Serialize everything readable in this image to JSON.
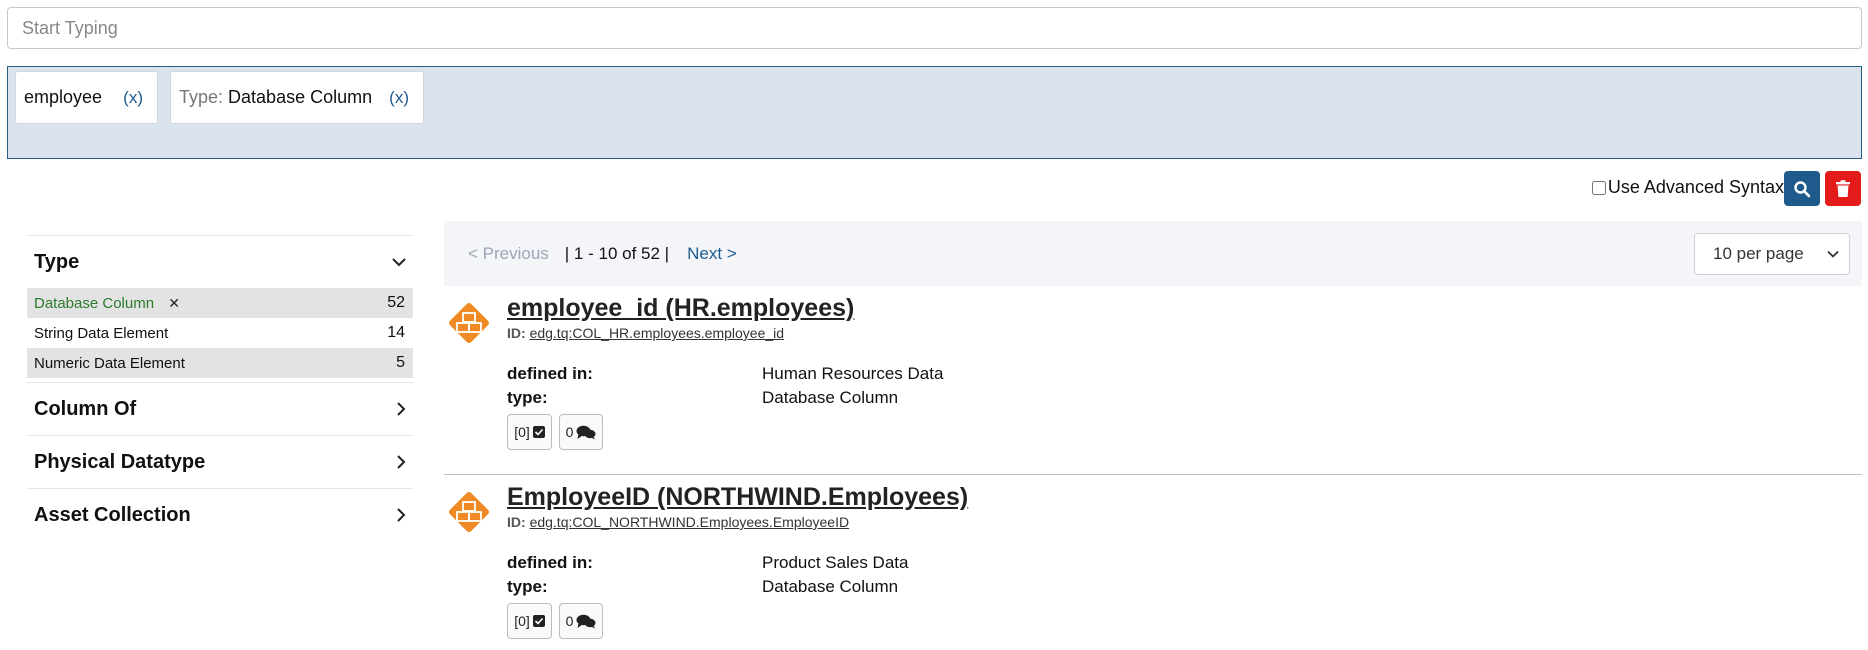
{
  "search": {
    "placeholder": "Start Typing"
  },
  "filters": [
    {
      "label": "",
      "value": "employee",
      "remove": "(x)"
    },
    {
      "label": "Type:",
      "value": "Database Column",
      "remove": "(x)"
    }
  ],
  "advanced": {
    "label": "Use Advanced Syntax",
    "checked": false
  },
  "buttons": {
    "search": "search-icon",
    "clear": "trash-icon"
  },
  "facets": {
    "type": {
      "title": "Type",
      "items": [
        {
          "label": "Database Column",
          "count": "52",
          "selected": true
        },
        {
          "label": "String Data Element",
          "count": "14"
        },
        {
          "label": "Numeric Data Element",
          "count": "5"
        }
      ]
    },
    "column_of": {
      "title": "Column Of"
    },
    "physical_datatype": {
      "title": "Physical Datatype"
    },
    "asset_collection": {
      "title": "Asset Collection"
    }
  },
  "pager": {
    "previous": "< Previous",
    "range": "| 1 - 10 of 52 |",
    "next": "Next >",
    "per_page": "10 per page"
  },
  "results": [
    {
      "title": "employee_id (HR.employees)",
      "id_label": "ID:",
      "id_value": "edg.tq:COL_HR.employees.employee_id",
      "defined_in_label": "defined in:",
      "defined_in": "Human Resources Data",
      "type_label": "type:",
      "type": "Database Column",
      "tasks": "[0]",
      "comments": "0"
    },
    {
      "title": "EmployeeID (NORTHWIND.Employees)",
      "id_label": "ID:",
      "id_value": "edg.tq:COL_NORTHWIND.Employees.EmployeeID",
      "defined_in_label": "defined in:",
      "defined_in": "Product Sales Data",
      "type_label": "type:",
      "type": "Database Column",
      "tasks": "[0]",
      "comments": "0"
    }
  ],
  "colors": {
    "accent": "#1e5a8c",
    "danger": "#e31b1b",
    "icon": "#f08a24",
    "selected": "#2b7a2b"
  }
}
